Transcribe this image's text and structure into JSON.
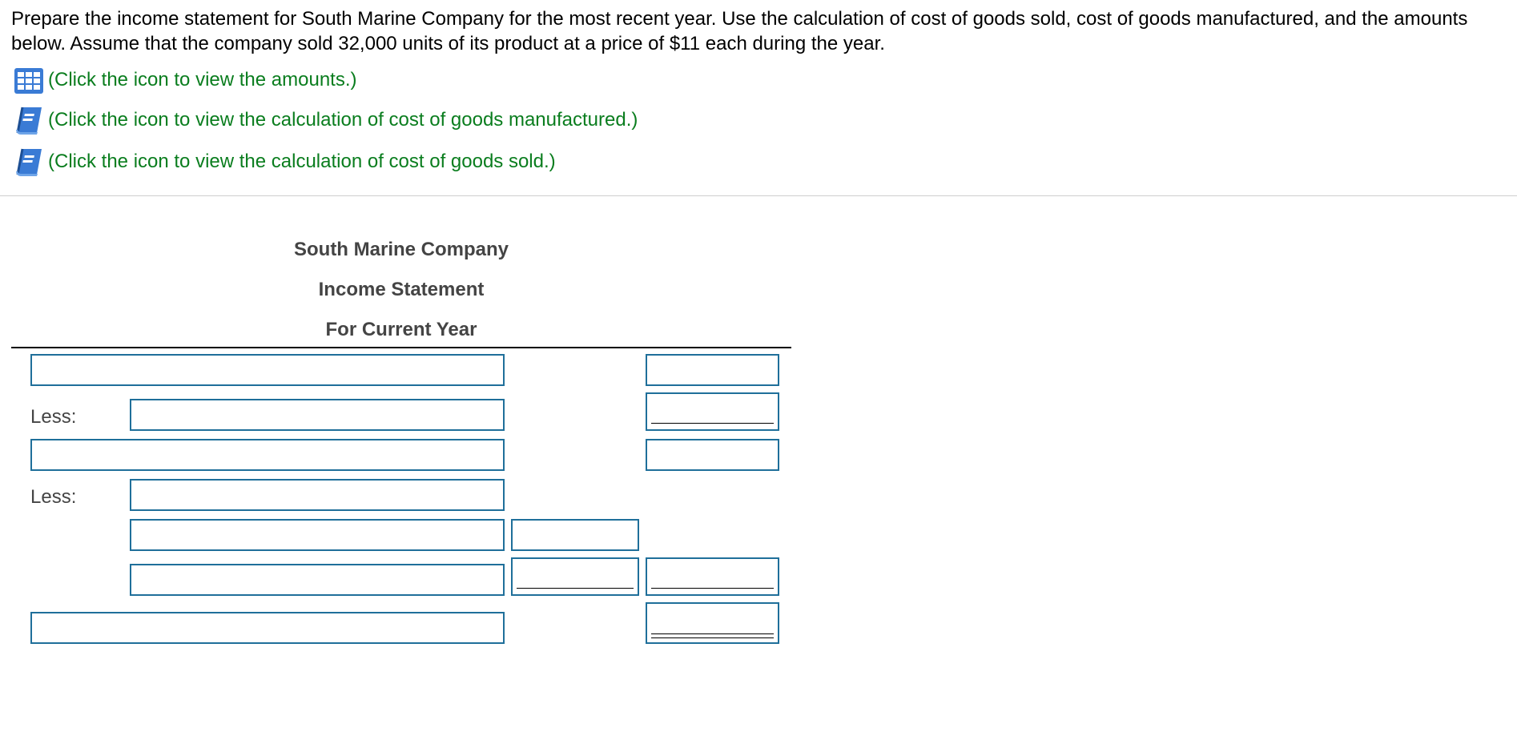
{
  "instructions": "Prepare the income statement for South Marine Company for the most recent year. Use the calculation of cost of goods sold, cost of goods manufactured, and the amounts below. Assume that the company sold 32,000 units of its product at a price of $11 each during the year.",
  "links": [
    {
      "icon": "data-table-icon",
      "text": "(Click the icon to view the amounts.)"
    },
    {
      "icon": "book-icon",
      "text": "(Click the icon to view the calculation of cost of goods manufactured.)"
    },
    {
      "icon": "book-icon",
      "text": "(Click the icon to view the calculation of cost of goods sold.)"
    }
  ],
  "statement": {
    "company": "South Marine Company",
    "title": "Income Statement",
    "period": "For Current Year"
  },
  "labels": {
    "less_1": "Less:",
    "less_2": "Less:"
  },
  "colors": {
    "link_text": "#0a7d1e",
    "input_border": "#1f6f9a",
    "heading_text": "#444444",
    "icon_blue": "#3a7bd5"
  }
}
